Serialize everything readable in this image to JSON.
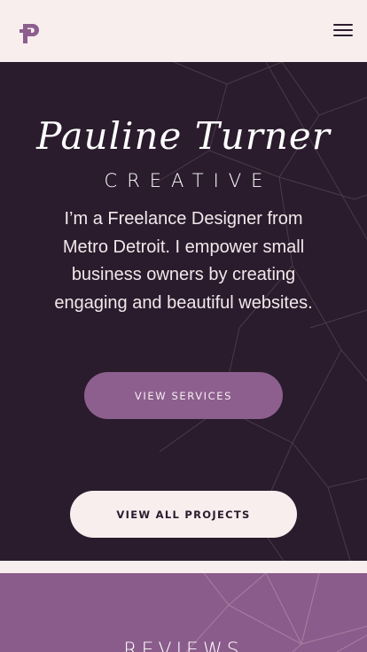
{
  "header": {
    "logo_icon": "p-monogram-icon",
    "menu_icon": "hamburger-menu-icon"
  },
  "hero": {
    "name": "Pauline Turner",
    "tagline": "CREATIVE",
    "intro": "I’m a Freelance Designer from Metro Detroit. I empower small business owners by creating engaging and beautiful websites.",
    "services_button": "VIEW SERVICES",
    "projects_button": "VIEW ALL PROJECTS"
  },
  "reviews": {
    "title": "REVIEWS"
  },
  "colors": {
    "page_bg": "#f8eeee",
    "hero_bg": "#2a1c2d",
    "accent": "#8d5f8e",
    "reviews_bg": "#8a5c8b",
    "pattern_line": "#4e3c4c"
  }
}
